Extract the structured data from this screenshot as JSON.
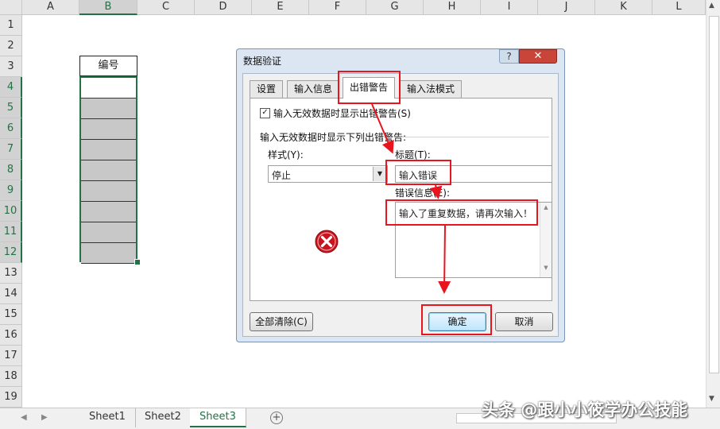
{
  "spreadsheet": {
    "columns": [
      "A",
      "B",
      "C",
      "D",
      "E",
      "F",
      "G",
      "H",
      "I",
      "J",
      "K",
      "L"
    ],
    "selected_column": "B",
    "rows": [
      "1",
      "2",
      "3",
      "4",
      "5",
      "6",
      "7",
      "8",
      "9",
      "10",
      "11",
      "12",
      "13",
      "14",
      "15",
      "16",
      "17",
      "18",
      "19"
    ],
    "selected_rows": [
      "4",
      "5",
      "6",
      "7",
      "8",
      "9",
      "10",
      "11",
      "12"
    ],
    "header_cell": "编号"
  },
  "sheet_tabs": [
    "Sheet1",
    "Sheet2",
    "Sheet3"
  ],
  "active_sheet": "Sheet3",
  "dialog": {
    "title": "数据验证",
    "help_glyph": "?",
    "close_glyph": "✕",
    "tabs": [
      "设置",
      "输入信息",
      "出错警告",
      "输入法模式"
    ],
    "active_tab": "出错警告",
    "show_error_checkbox": {
      "label": "输入无效数据时显示出错警告(S)",
      "checked": true
    },
    "section_label": "输入无效数据时显示下列出错警告:",
    "style_label": "样式(Y):",
    "style_value": "停止",
    "title_label": "标题(T):",
    "title_value": "输入错误",
    "message_label": "错误信息(E):",
    "message_value": "输入了重复数据，请再次输入！",
    "clear_all_button": "全部清除(C)",
    "ok_button": "确定",
    "cancel_button": "取消",
    "icon": "error-stop-icon"
  },
  "watermark": "头条 @跟小小筱学办公技能",
  "colors": {
    "accent": "#217346",
    "highlight": "#e8141e",
    "error_icon": "#c8141e"
  }
}
